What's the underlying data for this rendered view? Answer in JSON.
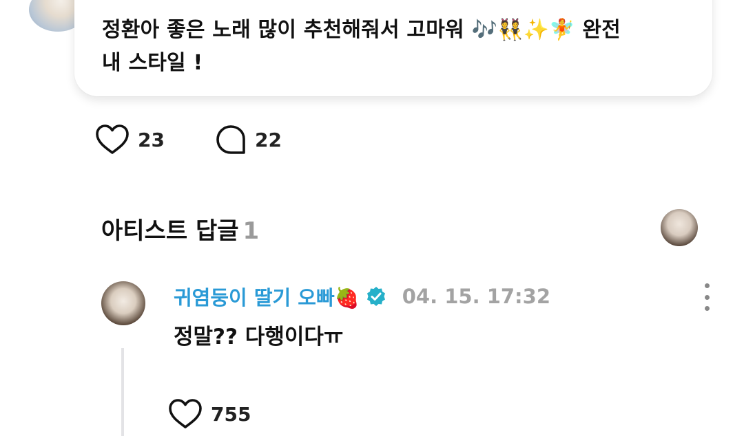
{
  "post": {
    "text_line1": "정환아 좋은 노래 많이 추천해줘서 고마워 🎶👯✨🧚 완전",
    "text_line2": "내 스타일 !",
    "like_count": "23",
    "comment_count": "22"
  },
  "artist_replies": {
    "title": "아티스트 답글",
    "count": "1"
  },
  "reply": {
    "author": "귀염둥이 딸기 오빠🍓",
    "timestamp": "04. 15. 17:32",
    "text": "정말?? 다행이다ㅠ",
    "like_count": "755"
  },
  "colors": {
    "accent_author": "#2a9ad6",
    "verified_badge": "#26b0c9",
    "muted": "#a3a3a3"
  },
  "icons": {
    "like": "heart-outline-icon",
    "comment": "speech-bubble-icon",
    "verified": "verified-badge-icon",
    "more": "more-vertical-icon"
  }
}
